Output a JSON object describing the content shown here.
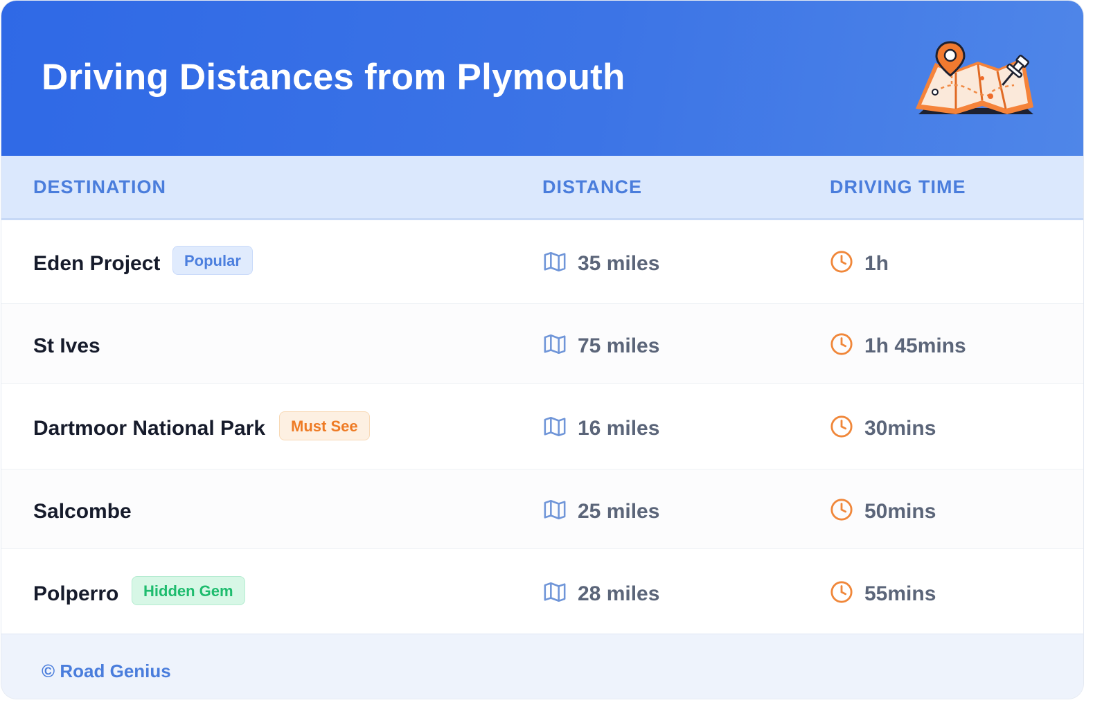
{
  "header": {
    "title": "Driving Distances from Plymouth",
    "illustration": "map-with-pins-icon"
  },
  "table": {
    "columns": [
      "DESTINATION",
      "DISTANCE",
      "DRIVING TIME"
    ],
    "rows": [
      {
        "destination": "Eden Project",
        "badge": "Popular",
        "badge_color": "#4c7fde",
        "distance": "35 miles",
        "time": "1h"
      },
      {
        "destination": "St Ives",
        "badge": "",
        "badge_color": "",
        "distance": "75 miles",
        "time": "1h 45mins"
      },
      {
        "destination": "Dartmoor National Park",
        "badge": "Must See",
        "badge_color": "#ee7b25",
        "distance": "16 miles",
        "time": "30mins"
      },
      {
        "destination": "Salcombe",
        "badge": "",
        "badge_color": "",
        "distance": "25 miles",
        "time": "50mins"
      },
      {
        "destination": "Polperro",
        "badge": "Hidden Gem",
        "badge_color": "#1ebc6e",
        "distance": "28 miles",
        "time": "55mins"
      }
    ],
    "distance_icon": "map-icon",
    "time_icon": "clock-icon"
  },
  "footer": {
    "credit": "© Road Genius"
  },
  "colors": {
    "header_blue": "#2f69e6",
    "accent_blue": "#4a7ddc",
    "accent_orange": "#f0873a"
  }
}
